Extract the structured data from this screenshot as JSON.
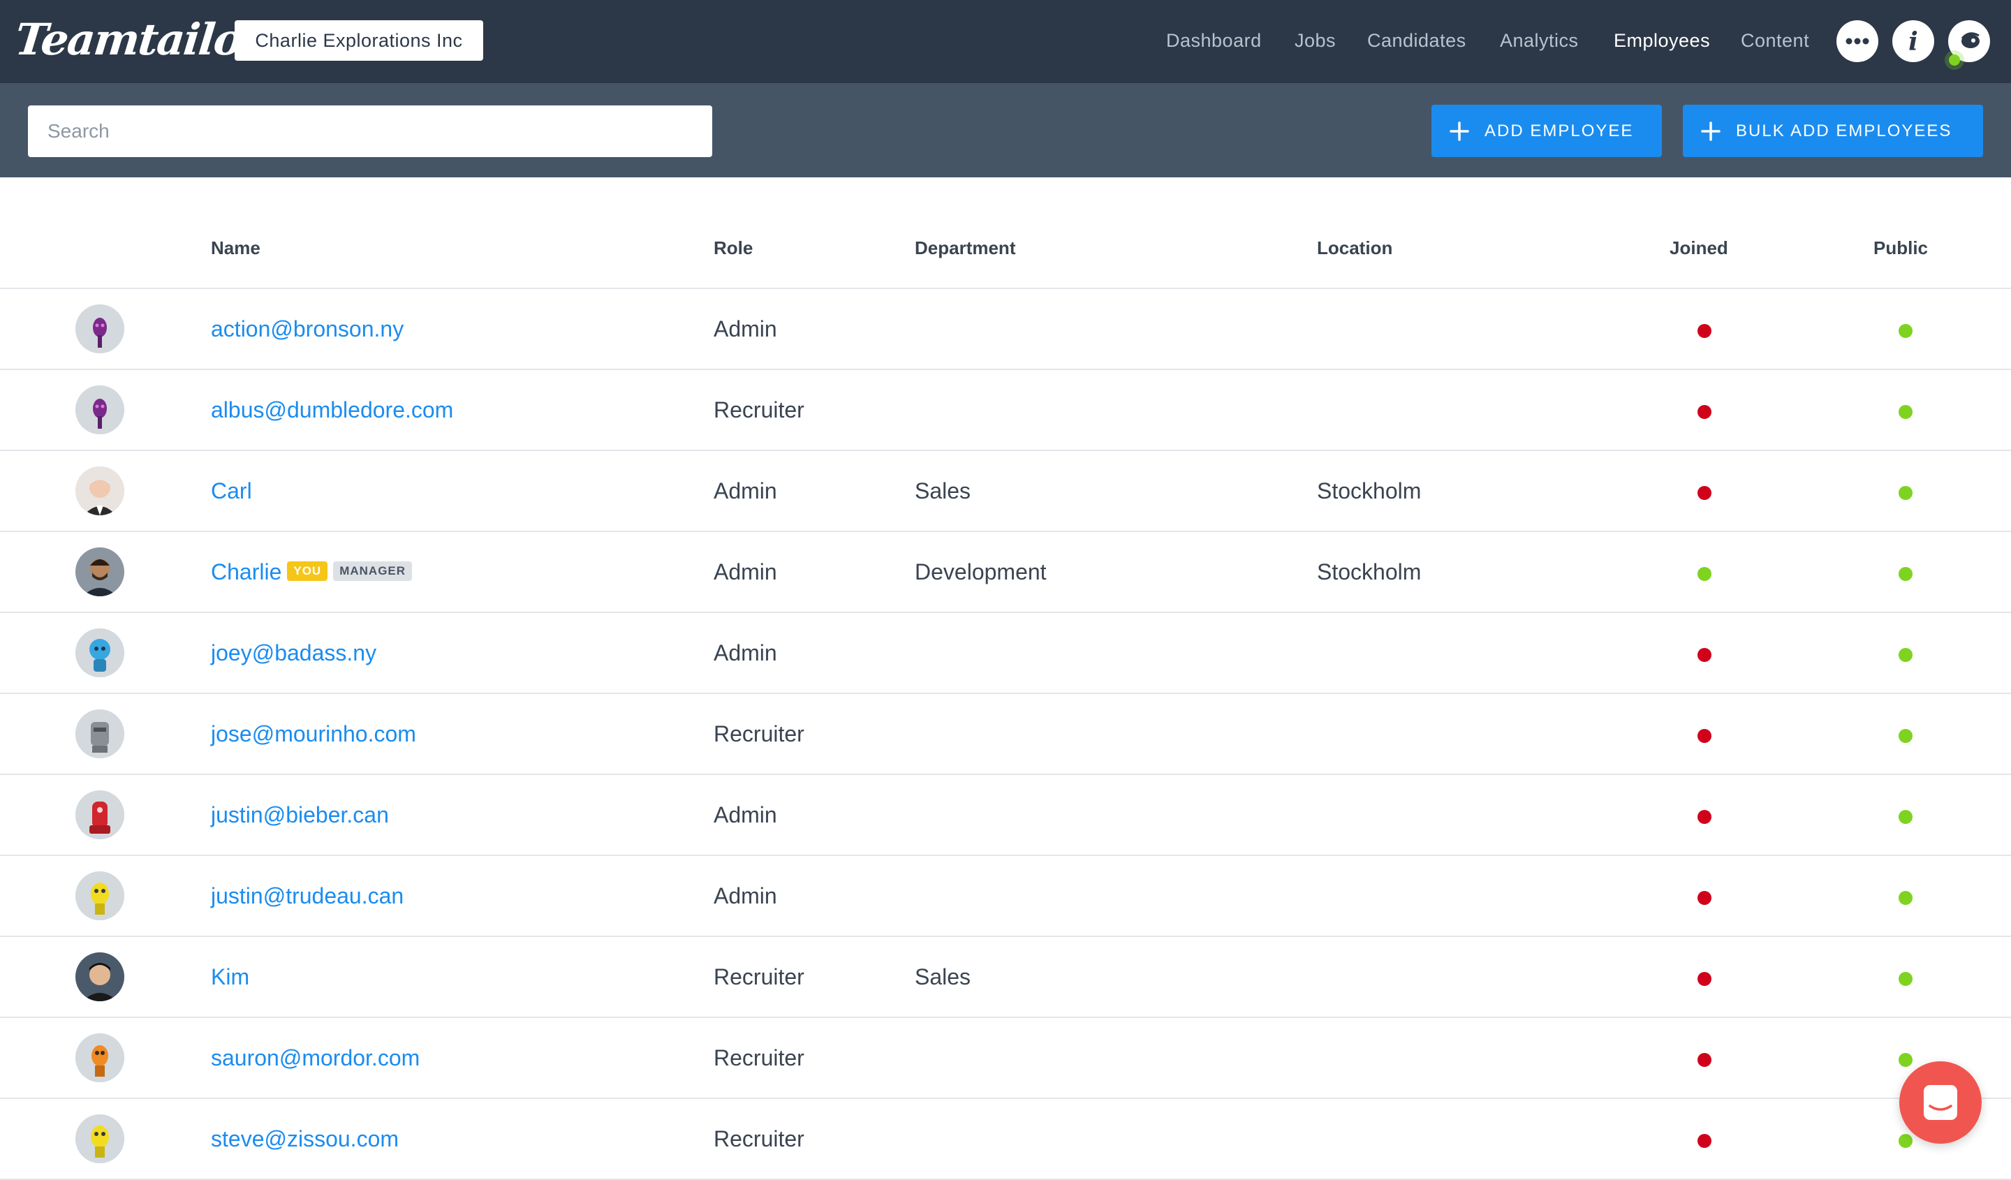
{
  "app": {
    "logo_text": "Teamtailor",
    "company": "Charlie Explorations Inc"
  },
  "nav": {
    "items": [
      {
        "label": "Dashboard",
        "active": false
      },
      {
        "label": "Jobs",
        "active": false
      },
      {
        "label": "Candidates",
        "active": false
      },
      {
        "label": "Analytics",
        "active": false
      },
      {
        "label": "Employees",
        "active": true
      },
      {
        "label": "Content",
        "active": false
      }
    ],
    "icons": [
      "more-icon",
      "info-icon",
      "user-avatar-icon"
    ]
  },
  "toolbar": {
    "search_placeholder": "Search",
    "search_value": "",
    "add_employee_label": "ADD EMPLOYEE",
    "bulk_add_label": "BULK ADD EMPLOYEES"
  },
  "table": {
    "headers": {
      "name": "Name",
      "role": "Role",
      "department": "Department",
      "location": "Location",
      "joined": "Joined",
      "public": "Public"
    },
    "rows": [
      {
        "name": "action@bronson.ny",
        "role": "Admin",
        "department": "",
        "location": "",
        "joined": false,
        "public": true,
        "avatar": "robot-purple"
      },
      {
        "name": "albus@dumbledore.com",
        "role": "Recruiter",
        "department": "",
        "location": "",
        "joined": false,
        "public": true,
        "avatar": "robot-purple"
      },
      {
        "name": "Carl",
        "role": "Admin",
        "department": "Sales",
        "location": "Stockholm",
        "joined": false,
        "public": true,
        "avatar": "photo-carl"
      },
      {
        "name": "Charlie",
        "badges": [
          "YOU",
          "MANAGER"
        ],
        "role": "Admin",
        "department": "Development",
        "location": "Stockholm",
        "joined": true,
        "public": true,
        "avatar": "photo-charlie"
      },
      {
        "name": "joey@badass.ny",
        "role": "Admin",
        "department": "",
        "location": "",
        "joined": false,
        "public": true,
        "avatar": "robot-blue"
      },
      {
        "name": "jose@mourinho.com",
        "role": "Recruiter",
        "department": "",
        "location": "",
        "joined": false,
        "public": true,
        "avatar": "robot-gray"
      },
      {
        "name": "justin@bieber.can",
        "role": "Admin",
        "department": "",
        "location": "",
        "joined": false,
        "public": true,
        "avatar": "robot-red"
      },
      {
        "name": "justin@trudeau.can",
        "role": "Admin",
        "department": "",
        "location": "",
        "joined": false,
        "public": true,
        "avatar": "robot-yellow"
      },
      {
        "name": "Kim",
        "role": "Recruiter",
        "department": "Sales",
        "location": "",
        "joined": false,
        "public": true,
        "avatar": "photo-kim"
      },
      {
        "name": "sauron@mordor.com",
        "role": "Recruiter",
        "department": "",
        "location": "",
        "joined": false,
        "public": true,
        "avatar": "robot-orange"
      },
      {
        "name": "steve@zissou.com",
        "role": "Recruiter",
        "department": "",
        "location": "",
        "joined": false,
        "public": true,
        "avatar": "robot-yellow"
      }
    ]
  },
  "colors": {
    "nav_bg": "#2c3847",
    "toolbar_bg": "#455566",
    "accent": "#1a8cf0",
    "dot_red": "#d0021b",
    "dot_green": "#7ed321",
    "chat": "#f0564f"
  }
}
